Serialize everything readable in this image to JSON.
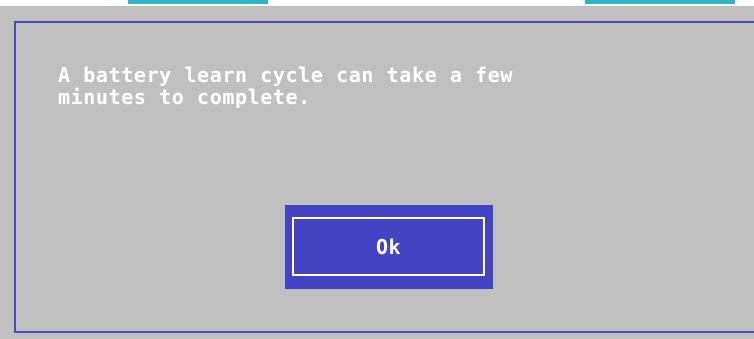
{
  "dialog": {
    "message": "A battery learn cycle can take a few\nminutes to complete.",
    "ok_label": "Ok"
  },
  "colors": {
    "dialog_background": "#c0c0c0",
    "border": "#4b4bb3",
    "button_background": "#4343c3",
    "text": "#ffffff",
    "top_tab": "#2fb3c7"
  }
}
